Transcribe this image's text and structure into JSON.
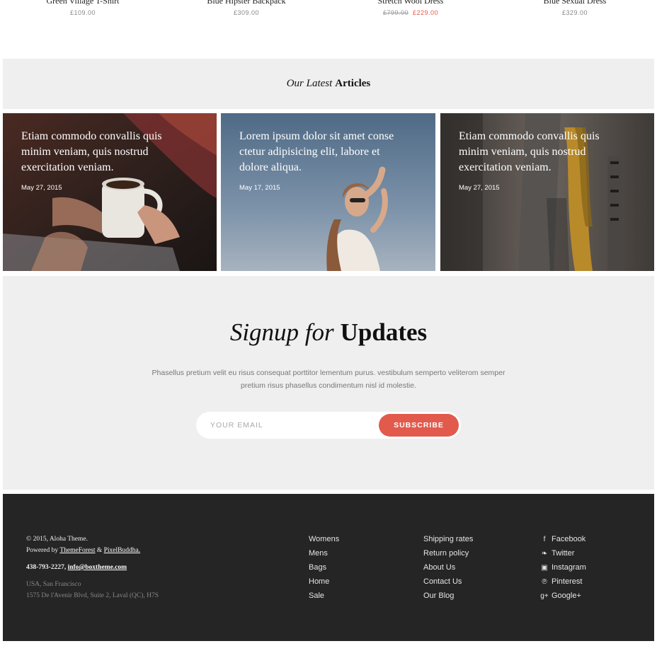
{
  "products": [
    {
      "name": "Green Village T-Shirt",
      "price": "£109.00",
      "old_price": "",
      "sale_price": ""
    },
    {
      "name": "Blue Hipster Backpack",
      "price": "£309.00",
      "old_price": "",
      "sale_price": ""
    },
    {
      "name": "Stretch Wool Dress",
      "price": "",
      "old_price": "£799.00",
      "sale_price": "£229.00"
    },
    {
      "name": "Blue Sexual Dress",
      "price": "£329.00",
      "old_price": "",
      "sale_price": ""
    }
  ],
  "articles": {
    "heading_italic": "Our Latest",
    "heading_bold": "Articles",
    "items": [
      {
        "title": "Etiam commodo convallis quis minim veniam, quis nostrud exercitation veniam.",
        "date": "May 27, 2015"
      },
      {
        "title": "Lorem ipsum dolor sit amet conse ctetur adipisicing elit, labore et dolore aliqua.",
        "date": "May 17, 2015"
      },
      {
        "title": "Etiam commodo convallis quis minim veniam, quis nostrud exercitation veniam.",
        "date": "May 27, 2015"
      }
    ]
  },
  "signup": {
    "title_italic": "Signup for",
    "title_bold": "Updates",
    "description": "Phasellus pretium velit eu risus consequat porttitor lementum purus. vestibulum semperto veliterom semper pretium risus phasellus  condimentum nisl id molestie.",
    "email_placeholder": "YOUR EMAIL",
    "button_label": "SUBSCRIBE"
  },
  "footer": {
    "copyright": "© 2015, Aloha Theme.",
    "powered_prefix": "Powered by",
    "powered_link1": "ThemeForest",
    "powered_amp": "&",
    "powered_link2": "PixelBuddha.",
    "phone": "438-793-2227,",
    "email": "info@boxtheme.com",
    "city": "USA, San Francisco",
    "address": "1575 De l'Avenir Blvd, Suite 2, Laval (QC), H7S",
    "col1": [
      "Womens",
      "Mens",
      "Bags",
      "Home",
      "Sale"
    ],
    "col2": [
      "Shipping rates",
      "Return policy",
      "About Us",
      "Contact Us",
      "Our Blog"
    ],
    "social": [
      {
        "icon": "facebook-icon",
        "glyph": "f",
        "label": "Facebook"
      },
      {
        "icon": "twitter-icon",
        "glyph": "❧",
        "label": "Twitter"
      },
      {
        "icon": "instagram-icon",
        "glyph": "▣",
        "label": "Instagram"
      },
      {
        "icon": "pinterest-icon",
        "glyph": "℗",
        "label": "Pinterest"
      },
      {
        "icon": "google-plus-icon",
        "glyph": "g+",
        "label": "Google+"
      }
    ]
  },
  "colors": {
    "accent": "#e25a4c",
    "footer_bg": "#252525",
    "section_bg": "#efefef"
  }
}
